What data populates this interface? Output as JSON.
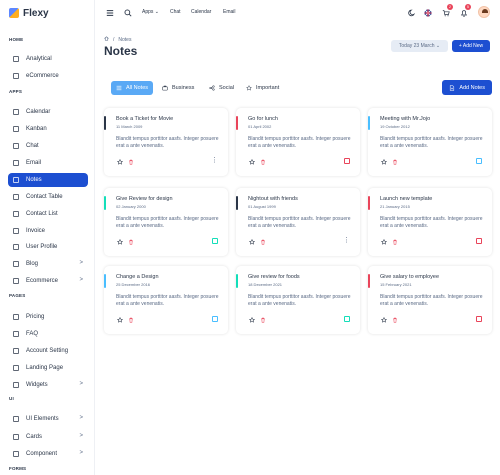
{
  "brand": {
    "name": "Flexy"
  },
  "sidebar": {
    "sections": {
      "home": "HOME",
      "apps": "APPS",
      "pages": "PAGES",
      "ui": "UI",
      "forms": "FORMS"
    },
    "items": [
      {
        "label": "Analytical",
        "icon": "aperture-icon"
      },
      {
        "label": "eCommerce",
        "icon": "shopping-cart-icon"
      },
      {
        "label": "Calendar",
        "icon": "calendar-icon"
      },
      {
        "label": "Kanban",
        "icon": "kanban-icon"
      },
      {
        "label": "Chat",
        "icon": "chat-icon"
      },
      {
        "label": "Email",
        "icon": "mail-icon"
      },
      {
        "label": "Notes",
        "icon": "notes-icon",
        "active": true
      },
      {
        "label": "Contact Table",
        "icon": "phone-icon"
      },
      {
        "label": "Contact List",
        "icon": "contact-list-icon"
      },
      {
        "label": "Invoice",
        "icon": "invoice-icon"
      },
      {
        "label": "User Profile",
        "icon": "user-icon"
      },
      {
        "label": "Blog",
        "icon": "blog-icon",
        "chevron": ">"
      },
      {
        "label": "Ecommerce",
        "icon": "basket-icon",
        "chevron": ">"
      },
      {
        "label": "Pricing",
        "icon": "currency-icon"
      },
      {
        "label": "FAQ",
        "icon": "help-icon"
      },
      {
        "label": "Account Setting",
        "icon": "user-circle-icon"
      },
      {
        "label": "Landing Page",
        "icon": "app-window-icon"
      },
      {
        "label": "Widgets",
        "icon": "widgets-icon",
        "chevron": ">"
      },
      {
        "label": "UI Elements",
        "icon": "layout-grid-icon",
        "chevron": ">"
      },
      {
        "label": "Cards",
        "icon": "cards-icon",
        "chevron": ">"
      },
      {
        "label": "Component",
        "icon": "components-icon",
        "chevron": ">"
      }
    ]
  },
  "header": {
    "links": {
      "apps": "Apps",
      "chat": "Chat",
      "calendar": "Calendar",
      "email": "Email"
    },
    "apps_chevron": "⌄",
    "cart_badge": "2",
    "notif_badge": "5"
  },
  "page": {
    "breadcrumb_sep": "/",
    "breadcrumb_current": "Notes",
    "title": "Notes",
    "date_button": "Today 23 March",
    "date_chevron": "⌄",
    "add_new": "+ Add New"
  },
  "tabs": {
    "all": "All Notes",
    "business": "Business",
    "social": "Social",
    "important": "Important",
    "add_notes": "Add Notes"
  },
  "colors": {
    "primary": "#1d4fd1",
    "tab_active": "#5aa9f5",
    "dark": "#2a3547",
    "red": "#e9445a",
    "teal": "#13deb9",
    "blue": "#49beff"
  },
  "notes": [
    {
      "title": "Book a Ticket for Movie",
      "date": "11 March 2009",
      "body": "Blandit tempus porttitor aasfs. Integer posuere erat a ante venenatis.",
      "accent": "#2a3547",
      "marker": "more"
    },
    {
      "title": "Go for lunch",
      "date": "01 April 2002",
      "body": "Blandit tempus porttitor aasfs. Integer posuere erat a ante venenatis.",
      "accent": "#e9445a",
      "marker": "#e9445a"
    },
    {
      "title": "Meeting with Mr.Jojo",
      "date": "19 October 2012",
      "body": "Blandit tempus porttitor aasfs. Integer posuere erat a ante venenatis.",
      "accent": "#49beff",
      "marker": "#49beff"
    },
    {
      "title": "Give Review for design",
      "date": "02 January 2000",
      "body": "Blandit tempus porttitor aasfs. Integer posuere erat a ante venenatis.",
      "accent": "#13deb9",
      "marker": "#13deb9"
    },
    {
      "title": "Nightout with friends",
      "date": "01 August 1999",
      "body": "Blandit tempus porttitor aasfs. Integer posuere erat a ante venenatis.",
      "accent": "#2a3547",
      "marker": "more"
    },
    {
      "title": "Launch new template",
      "date": "21 January 2015",
      "body": "Blandit tempus porttitor aasfs. Integer posuere erat a ante venenatis.",
      "accent": "#e9445a",
      "marker": "#e9445a"
    },
    {
      "title": "Change a Design",
      "date": "25 December 2016",
      "body": "Blandit tempus porttitor aasfs. Integer posuere erat a ante venenatis.",
      "accent": "#49beff",
      "marker": "#49beff"
    },
    {
      "title": "Give review for foods",
      "date": "18 December 2021",
      "body": "Blandit tempus porttitor aasfs. Integer posuere erat a ante venenatis.",
      "accent": "#13deb9",
      "marker": "#13deb9"
    },
    {
      "title": "Give salary to employee",
      "date": "15 February 2021",
      "body": "Blandit tempus porttitor aasfs. Integer posuere erat a ante venenatis.",
      "accent": "#e9445a",
      "marker": "#e9445a"
    }
  ],
  "notes_more_glyph": "⋮"
}
